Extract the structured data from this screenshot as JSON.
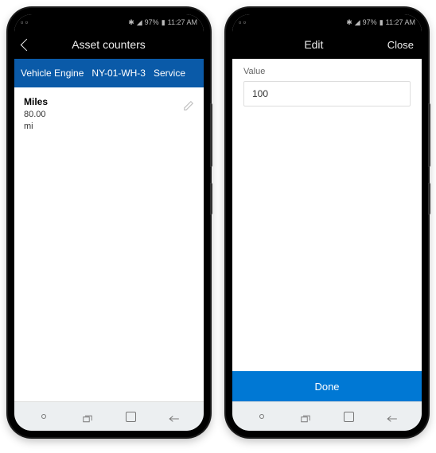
{
  "status": {
    "time": "11:27 AM",
    "battery": "97%",
    "icons_left": "◻ ⟳",
    "icons_right": "✱ ✈ ◢"
  },
  "phone1": {
    "header_title": "Asset counters",
    "bluebar": {
      "asset_type": "Vehicle Engine",
      "asset_id": "NY-01-WH-3",
      "extra": "Service"
    },
    "counter": {
      "name": "Miles",
      "value": "80.00",
      "unit": "mi"
    }
  },
  "phone2": {
    "header_title": "Edit",
    "header_close": "Close",
    "field_label": "Value",
    "field_value": "100",
    "done_label": "Done"
  }
}
